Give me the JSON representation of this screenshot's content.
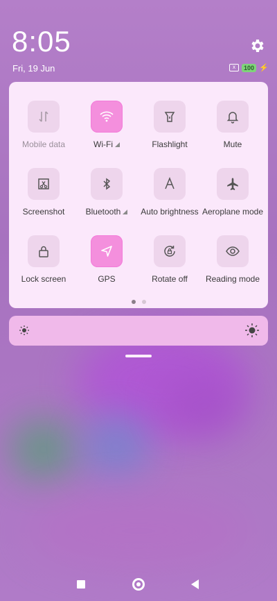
{
  "status_bar": {
    "time": "8:05",
    "date": "Fri, 19 Jun",
    "battery": "100",
    "sim_icon": "x"
  },
  "quick_settings": {
    "tiles": [
      {
        "label": "Mobile data",
        "icon": "mobile-data-icon",
        "active": false,
        "disabled": true
      },
      {
        "label": "Wi-Fi",
        "icon": "wifi-icon",
        "active": true,
        "expand": true
      },
      {
        "label": "Flashlight",
        "icon": "flashlight-icon",
        "active": false
      },
      {
        "label": "Mute",
        "icon": "bell-icon",
        "active": false
      },
      {
        "label": "Screenshot",
        "icon": "screenshot-icon",
        "active": false
      },
      {
        "label": "Bluetooth",
        "icon": "bluetooth-icon",
        "active": false,
        "expand": true
      },
      {
        "label": "Auto brightness",
        "icon": "auto-brightness-icon",
        "active": false
      },
      {
        "label": "Aeroplane mode",
        "icon": "aeroplane-icon",
        "active": false
      },
      {
        "label": "Lock screen",
        "icon": "lock-icon",
        "active": false
      },
      {
        "label": "GPS",
        "icon": "location-arrow-icon",
        "active": true
      },
      {
        "label": "Rotate off",
        "icon": "rotate-lock-icon",
        "active": false
      },
      {
        "label": "Reading mode",
        "icon": "eye-icon",
        "active": false
      }
    ],
    "page_count": 2,
    "current_page": 1
  },
  "brightness": {
    "level": 0.0
  },
  "colors": {
    "tile_active": "#f48fdd",
    "tile_inactive": "#eed5ec",
    "panel": "#fbe8fb",
    "slider_track": "#f0b9ea"
  }
}
